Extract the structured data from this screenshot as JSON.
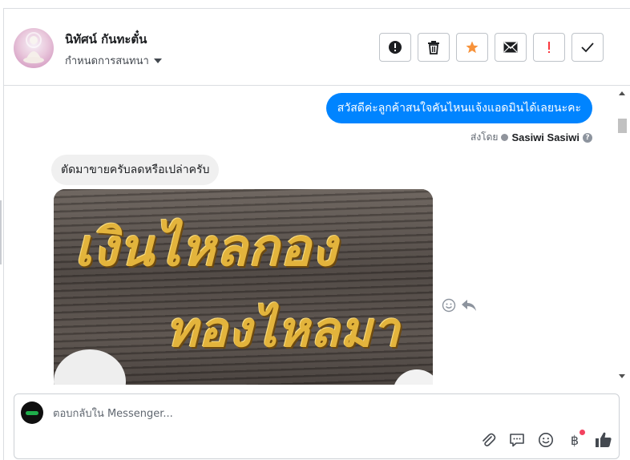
{
  "header": {
    "contact_name": "นิทัศน์ กันทะตั๋น",
    "assign_label": "กำหนดการสนทนา",
    "actions": {
      "spam": "spam-alert-icon",
      "delete": "trash-icon",
      "star": "star-icon",
      "mark_unread": "envelope-icon",
      "follow_up": "exclamation-icon",
      "done": "check-icon"
    }
  },
  "conversation": {
    "outgoing_message": "สวัสดีค่ะลูกค้าสนใจคันไหนแจ้งแอดมินได้เลยนะคะ",
    "sent_by_label": "ส่งโดย",
    "sent_by_agent": "Sasiwi Sasiwi",
    "incoming_message": "ตัดมาขายครับลดหรือเปล่าครับ",
    "photo_text_line1": "เงินไหลกอง",
    "photo_text_line2": "ทองไหลมา"
  },
  "composer": {
    "placeholder": "ตอบกลับใน Messenger..."
  },
  "colors": {
    "accent": "#0084ff",
    "star": "#f7923a",
    "follow_up": "#fa383e",
    "notification": "#f3425f"
  }
}
